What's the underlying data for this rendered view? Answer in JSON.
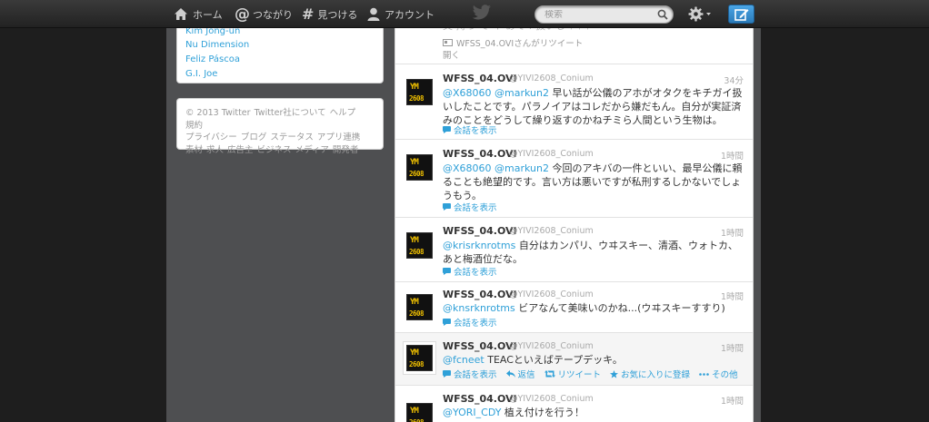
{
  "nav": {
    "home": "ホーム",
    "connect": "つながり",
    "discover": "見つける",
    "account": "アカウント"
  },
  "search": {
    "placeholder": "検索"
  },
  "colors": {
    "link": "#2fa0d8",
    "compose": "#2b7bb9",
    "topbar": "#2c2c2c"
  },
  "trends": {
    "items": [
      "Kim Jong-un",
      "Nu Dimension",
      "Feliz Páscoa",
      "G.I. Joe"
    ]
  },
  "footer": {
    "links": [
      "© 2013 Twitter",
      "Twitter社について",
      "ヘルプ",
      "規約",
      "プライバシー",
      "ブログ",
      "ステータス",
      "アプリ連携",
      "素材",
      "求人",
      "広告主",
      "ビジネス",
      "メディア",
      "開発者"
    ]
  },
  "timeline": {
    "top_partial": {
      "text_fragment": "又 持っ て イ あて  !  扱いし ｲ ｲ ｲ",
      "retweet_note": "WFSS_04.OVIさんがリツイート",
      "open_label": "開く"
    },
    "tweets": [
      {
        "name": "WFSS_04.OVI",
        "handle": "@YIVI2608_Conium",
        "time": "34分",
        "mention": "@X68060 @markun2",
        "text": " 早い話が公儀のアホがオタクをキチガイ扱いしたことです。パラノイアはコレだから嫌だもん。自分が実証済みのことをどうして繰り返すのかねチミら人間という生物は。",
        "conversation": "会話を表示"
      },
      {
        "name": "WFSS_04.OVI",
        "handle": "@YIVI2608_Conium",
        "time": "1時間",
        "mention": "@X68060 @markun2",
        "text": " 今回のアキバの一件といい、最早公儀に頼ることも絶望的です。言い方は悪いですが私刑するしかないでしょうもう。",
        "conversation": "会話を表示"
      },
      {
        "name": "WFSS_04.OVI",
        "handle": "@YIVI2608_Conium",
        "time": "1時間",
        "mention": "@krisrknrotms",
        "text": " 自分はカンパリ、ウヰスキー、清酒、ウォトカ、あと梅酒位だな。",
        "conversation": "会話を表示"
      },
      {
        "name": "WFSS_04.OVI",
        "handle": "@YIVI2608_Conium",
        "time": "1時間",
        "mention": "@knsrknrotms",
        "text": " ビアなんて美味いのかね...(ウヰスキーすすり)",
        "conversation": "会話を表示"
      },
      {
        "name": "WFSS_04.OVI",
        "handle": "@YIVI2608_Conium",
        "time": "1時間",
        "mention": "@fcneet",
        "text": " TEACといえばテープデッキ。",
        "actions": {
          "conversation": "会話を表示",
          "reply": "返信",
          "retweet": "リツイート",
          "favorite": "お気に入りに登録",
          "more": "その他"
        }
      },
      {
        "name": "WFSS_04.OVI",
        "handle": "@YIVI2608_Conium",
        "time": "1時間",
        "mention": "@YORI_CDY",
        "text": " 植え付けを行う！"
      }
    ]
  },
  "avatar": {
    "top": "YM",
    "bottom": "2608"
  }
}
